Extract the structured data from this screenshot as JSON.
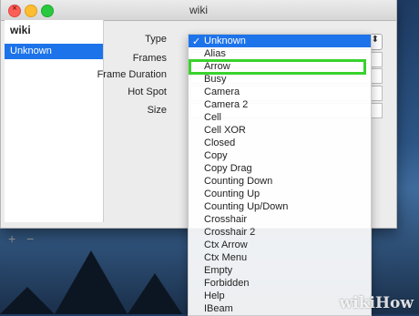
{
  "window": {
    "title": "wiki"
  },
  "sidebar": {
    "header": "wiki",
    "items": [
      {
        "label": "Unknown"
      }
    ],
    "add_label": "+",
    "remove_label": "−"
  },
  "form": {
    "labels": [
      "Type",
      "Frames",
      "Frame Duration",
      "Hot Spot",
      "Size"
    ]
  },
  "dropdown": {
    "selected_value": "Unknown",
    "check_glyph": "✓",
    "items": [
      "Unknown",
      "Alias",
      "Arrow",
      "Busy",
      "Camera",
      "Camera 2",
      "Cell",
      "Cell XOR",
      "Closed",
      "Copy",
      "Copy Drag",
      "Counting Down",
      "Counting Up",
      "Counting Up/Down",
      "Crosshair",
      "Crosshair 2",
      "Ctx Arrow",
      "Ctx Menu",
      "Empty",
      "Forbidden",
      "Help",
      "IBeam"
    ],
    "highlighted_item": "Arrow",
    "highlight_color": "#39d22d",
    "selection_color": "#1d73ea"
  },
  "watermark": "wikiHow"
}
